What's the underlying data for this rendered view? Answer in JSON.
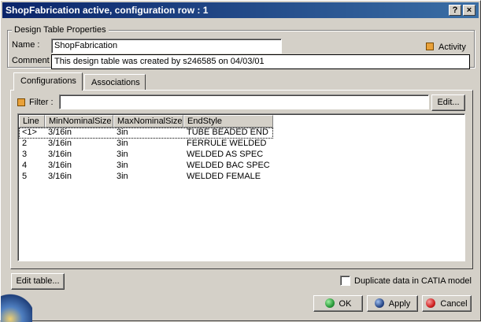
{
  "window": {
    "title": "ShopFabrication active, configuration row : 1",
    "help_btn": "?",
    "close_btn": "×"
  },
  "properties": {
    "legend": "Design Table Properties",
    "name_label": "Name :",
    "name_value": "ShopFabrication",
    "activity_label": "Activity",
    "comment_label": "Comment :",
    "comment_value": "This design table was created by s246585 on 04/03/01"
  },
  "tabs": [
    {
      "label": "Configurations",
      "active": true
    },
    {
      "label": "Associations",
      "active": false
    }
  ],
  "filter": {
    "label": "Filter :",
    "value": "",
    "edit_button": "Edit..."
  },
  "table": {
    "columns": [
      "Line",
      "MinNominalSize",
      "MaxNominalSize",
      "EndStyle"
    ],
    "rows": [
      [
        "<1>",
        "3/16in",
        "3in",
        "TUBE BEADED END"
      ],
      [
        "2",
        "3/16in",
        "3in",
        "FERRULE WELDED"
      ],
      [
        "3",
        "3/16in",
        "3in",
        "WELDED AS SPEC"
      ],
      [
        "4",
        "3/16in",
        "3in",
        "WELDED BAC SPEC"
      ],
      [
        "5",
        "3/16in",
        "3in",
        "WELDED FEMALE"
      ]
    ]
  },
  "footer": {
    "edit_table_button": "Edit table...",
    "duplicate_label": "Duplicate data in CATIA model",
    "ok_button": "OK",
    "apply_button": "Apply",
    "cancel_button": "Cancel"
  },
  "colors": {
    "title_bar": "#0a246a",
    "ok_icon": "#2a9a3a",
    "apply_icon": "#2a4a8a",
    "cancel_icon": "#d02020",
    "activity_check": "#e8a13a"
  }
}
